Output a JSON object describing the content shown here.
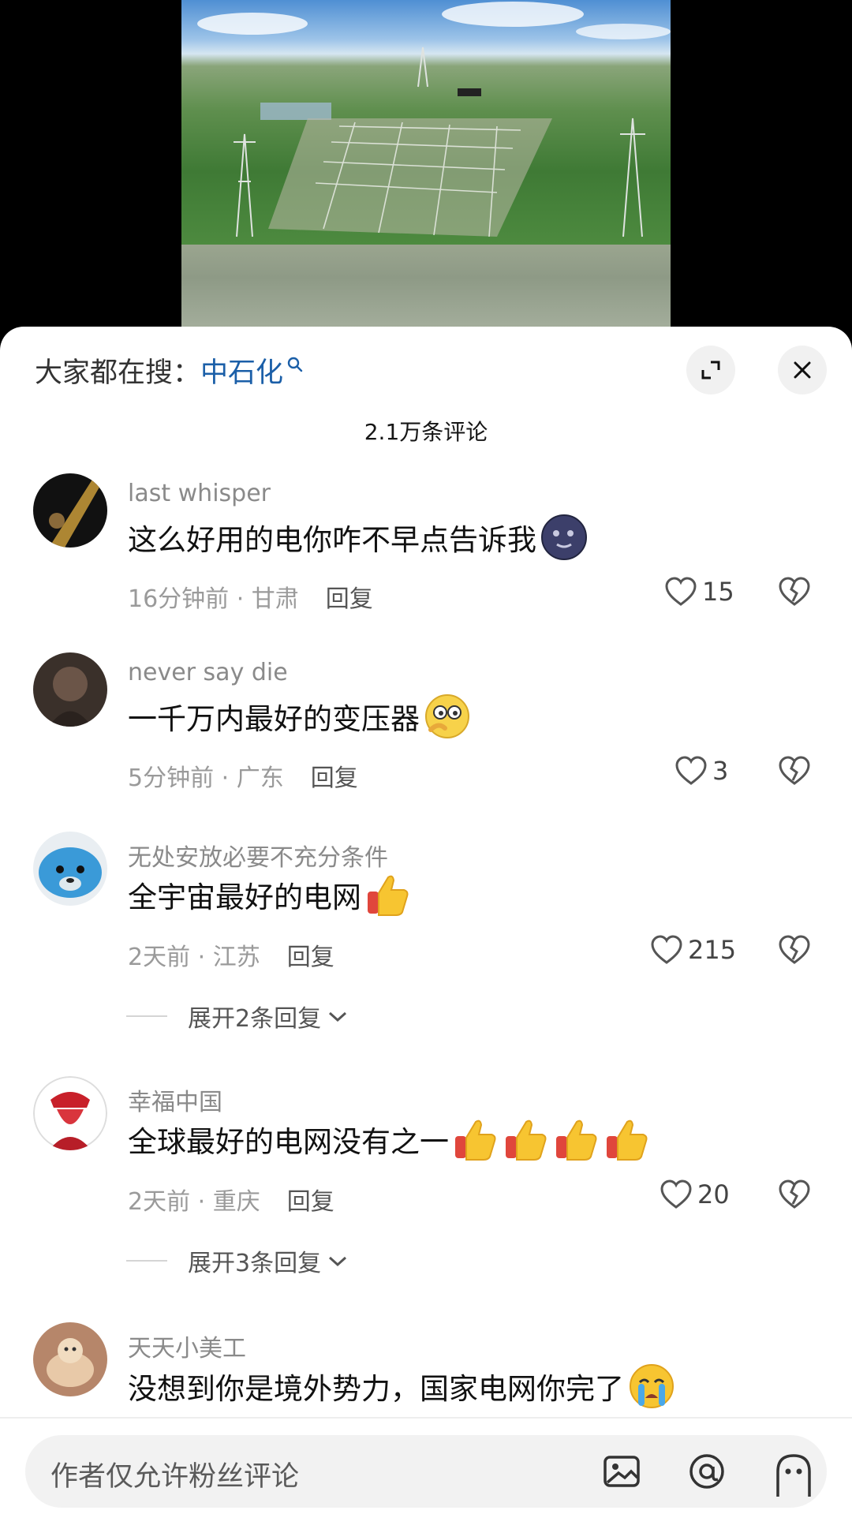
{
  "search": {
    "prefix": "大家都在搜：",
    "term": "中石化"
  },
  "comments_count_title": "2.1万条评论",
  "comments": [
    {
      "user": "last whisper",
      "text": "这么好用的电你咋不早点告诉我",
      "emoji": "new-moon-face-emoji",
      "time": "16分钟前",
      "location": "甘肃",
      "reply_label": "回复",
      "likes": "15"
    },
    {
      "user": "never say die",
      "text": "一千万内最好的变压器",
      "emoji": "thinking-eyes-emoji",
      "time": "5分钟前",
      "location": "广东",
      "reply_label": "回复",
      "likes": "3"
    },
    {
      "user": "无处安放必要不充分条件",
      "text": "全宇宙最好的电网",
      "emoji": "thumbs-up-emoji",
      "time": "2天前",
      "location": "江苏",
      "reply_label": "回复",
      "likes": "215",
      "expand_label": "展开2条回复"
    },
    {
      "user": "幸福中国",
      "text": "全球最好的电网没有之一",
      "emoji": "thumbs-up-emoji-x4",
      "time": "2天前",
      "location": "重庆",
      "reply_label": "回复",
      "likes": "20",
      "expand_label": "展开3条回复"
    },
    {
      "user": "天天小美工",
      "text": "没想到你是境外势力，国家电网你完了",
      "emoji": "crying-face-emoji"
    }
  ],
  "input": {
    "placeholder": "作者仅允许粉丝评论"
  },
  "meta_separator": " · ",
  "colors": {
    "link_blue": "#1b5fa8",
    "emoji_yellow": "#f7c531"
  },
  "icons": [
    "search-icon",
    "expand-icon",
    "close-icon",
    "heart-icon",
    "broken-heart-icon",
    "chevron-down-icon",
    "image-icon",
    "at-icon",
    "emoji-face-icon"
  ]
}
